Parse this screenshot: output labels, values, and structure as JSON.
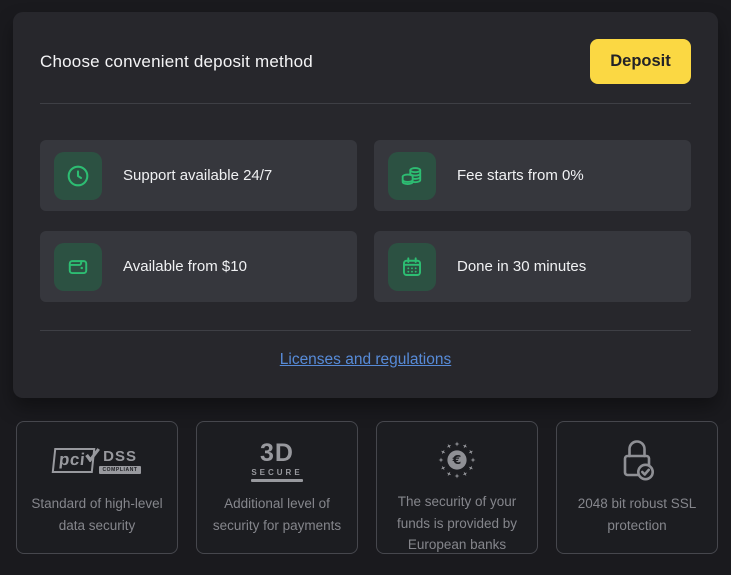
{
  "colors": {
    "page_background": "#1a1a1e",
    "card_background": "#27272c",
    "tile_background": "#36373d",
    "accent_yellow": "#fbd843",
    "accent_green": "#2dbd72",
    "icon_square_green": "#2c5142",
    "link_blue": "#578bd8"
  },
  "card": {
    "title": "Choose convenient deposit method",
    "deposit_button": "Deposit",
    "features": [
      {
        "icon": "clock-icon",
        "label": "Support available 24/7"
      },
      {
        "icon": "coins-icon",
        "label": "Fee starts from 0%"
      },
      {
        "icon": "wallet-icon",
        "label": "Available from $10"
      },
      {
        "icon": "calendar-icon",
        "label": "Done in 30 minutes"
      }
    ],
    "link": "Licenses and regulations"
  },
  "badges": [
    {
      "logo": {
        "pci": "pci",
        "dss": "DSS",
        "compliant": "COMPLIANT"
      },
      "caption": "Standard of high-level data security"
    },
    {
      "logo": {
        "big": "3D",
        "small": "SECURE"
      },
      "caption": "Additional level of security for payments"
    },
    {
      "logo": {
        "symbol": "€"
      },
      "caption": "The security of your funds is provided by European banks"
    },
    {
      "logo": {},
      "caption": "2048 bit robust SSL protection"
    }
  ]
}
